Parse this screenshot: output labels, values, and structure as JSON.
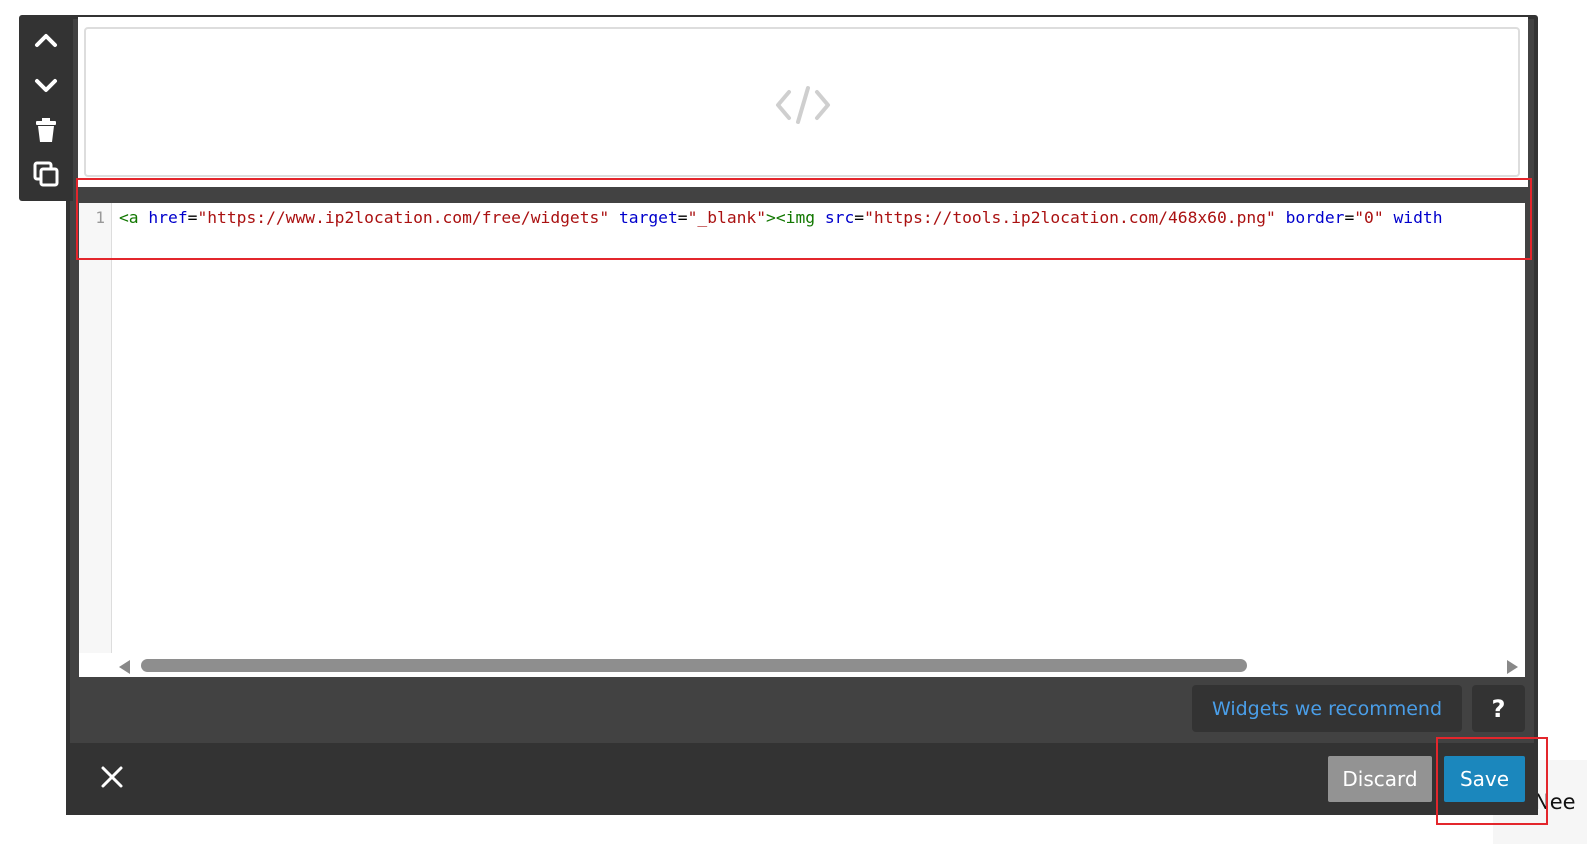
{
  "toolbar": {
    "items": [
      {
        "icon": "chevron-up-icon",
        "label": "Move up"
      },
      {
        "icon": "chevron-down-icon",
        "label": "Move down"
      },
      {
        "icon": "trash-icon",
        "label": "Delete"
      },
      {
        "icon": "duplicate-icon",
        "label": "Duplicate"
      }
    ]
  },
  "preview": {
    "icon": "code-icon"
  },
  "editor": {
    "line_number": "1",
    "tokens": {
      "t1": "<a",
      "t2": " ",
      "t3": "href",
      "t4": "=",
      "t5": "\"https://www.ip2location.com/free/widgets\"",
      "t6": " ",
      "t7": "target",
      "t8": "=",
      "t9": "\"_blank\"",
      "t10": "><img",
      "t11": " ",
      "t12": "src",
      "t13": "=",
      "t14": "\"https://tools.ip2location.com/468x60.png\"",
      "t15": " ",
      "t16": "border",
      "t17": "=",
      "t18": "\"0\"",
      "t19": " ",
      "t20": "width"
    }
  },
  "widgets": {
    "label": "Widgets we recommend",
    "help_label": "?"
  },
  "footer": {
    "discard_label": "Discard",
    "save_label": "Save"
  },
  "page_bleed_text": "Nee",
  "colors": {
    "frame": "#424242",
    "bar": "#333333",
    "save": "#1b87bd",
    "discard": "#939393",
    "link": "#4a9ee8",
    "highlight": "#e3262c"
  }
}
